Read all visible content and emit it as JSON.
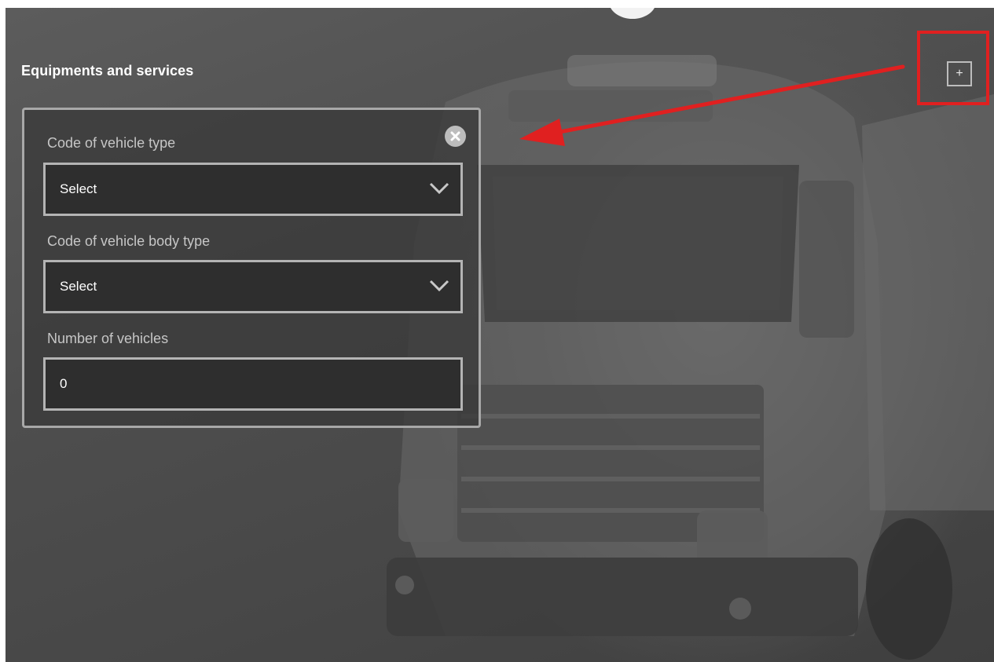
{
  "section": {
    "title": "Equipments and services"
  },
  "add_button": {
    "label": "+"
  },
  "form": {
    "vehicle_type": {
      "label": "Code of vehicle type",
      "value": "Select"
    },
    "vehicle_body_type": {
      "label": "Code of vehicle body type",
      "value": "Select"
    },
    "number_of_vehicles": {
      "label": "Number of vehicles",
      "value": "0"
    }
  },
  "icons": {
    "close": "close-icon",
    "chevron": "chevron-down-icon",
    "add": "plus-icon"
  },
  "colors": {
    "annotation": "#e02020",
    "panel_border": "#a8a8a8",
    "field_background": "#2e2e2e"
  }
}
